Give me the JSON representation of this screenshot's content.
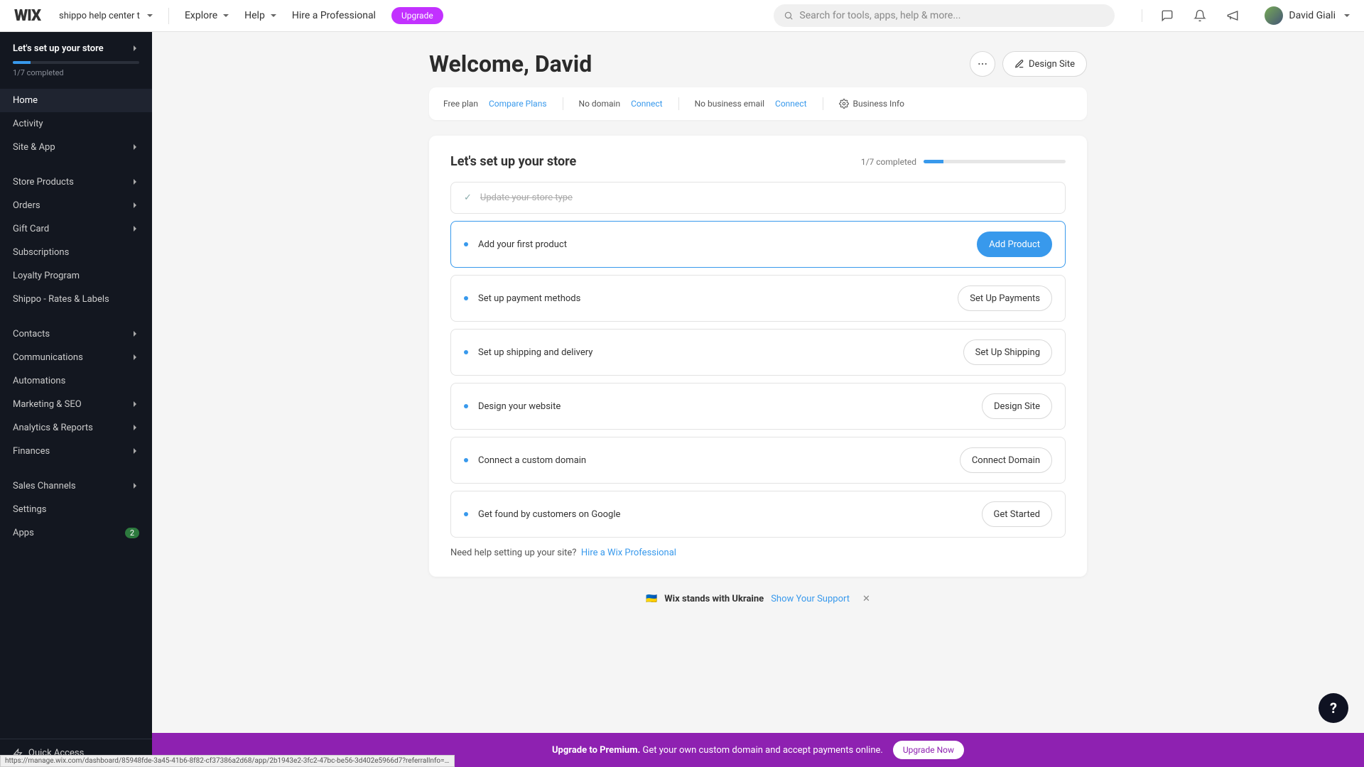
{
  "topbar": {
    "logo": "WIX",
    "site_name": "shippo help center t",
    "explore": "Explore",
    "help": "Help",
    "hire": "Hire a Professional",
    "upgrade": "Upgrade",
    "search_placeholder": "Search for tools, apps, help & more...",
    "user_name": "David Giali"
  },
  "sidebar": {
    "setup_title": "Let's set up your store",
    "progress_text": "1/7 completed",
    "items": [
      {
        "label": "Home",
        "active": true
      },
      {
        "label": "Activity"
      },
      {
        "label": "Site & App",
        "chev": true
      },
      {
        "label": "Store Products",
        "chev": true,
        "gap": true
      },
      {
        "label": "Orders",
        "chev": true
      },
      {
        "label": "Gift Card",
        "chev": true
      },
      {
        "label": "Subscriptions"
      },
      {
        "label": "Loyalty Program"
      },
      {
        "label": "Shippo - Rates & Labels"
      },
      {
        "label": "Contacts",
        "chev": true,
        "gap": true
      },
      {
        "label": "Communications",
        "chev": true
      },
      {
        "label": "Automations"
      },
      {
        "label": "Marketing & SEO",
        "chev": true
      },
      {
        "label": "Analytics & Reports",
        "chev": true
      },
      {
        "label": "Finances",
        "chev": true
      },
      {
        "label": "Sales Channels",
        "chev": true,
        "gap": true
      },
      {
        "label": "Settings"
      },
      {
        "label": "Apps",
        "badge": "2"
      }
    ],
    "quick_access": "Quick Access"
  },
  "header": {
    "welcome": "Welcome, David",
    "design_site": "Design Site"
  },
  "infobar": {
    "plan_label": "Free plan",
    "plan_action": "Compare Plans",
    "domain_label": "No domain",
    "domain_action": "Connect",
    "email_label": "No business email",
    "email_action": "Connect",
    "biz_info": "Business Info"
  },
  "setup": {
    "title": "Let's set up your store",
    "progress_text": "1/7 completed",
    "steps": [
      {
        "label": "Update your store type",
        "done": true
      },
      {
        "label": "Add your first product",
        "action": "Add Product",
        "active": true,
        "primary": true
      },
      {
        "label": "Set up payment methods",
        "action": "Set Up Payments"
      },
      {
        "label": "Set up shipping and delivery",
        "action": "Set Up Shipping"
      },
      {
        "label": "Design your website",
        "action": "Design Site"
      },
      {
        "label": "Connect a custom domain",
        "action": "Connect Domain"
      },
      {
        "label": "Get found by customers on Google",
        "action": "Get Started"
      }
    ],
    "help_text": "Need help setting up your site?",
    "help_link": "Hire a Wix Professional"
  },
  "banner": {
    "flag": "🇺🇦",
    "text": "Wix stands with Ukraine",
    "link": "Show Your Support"
  },
  "upgrade": {
    "bold": "Upgrade to Premium.",
    "text": "Get your own custom domain and accept payments online.",
    "button": "Upgrade Now"
  },
  "status_url": "https://manage.wix.com/dashboard/85948fde-3a45-41b6-8f82-cf37386a2d68/app/2b1943e2-3fc2-47bc-be56-3d402e5966d7?referralInfo=side..."
}
